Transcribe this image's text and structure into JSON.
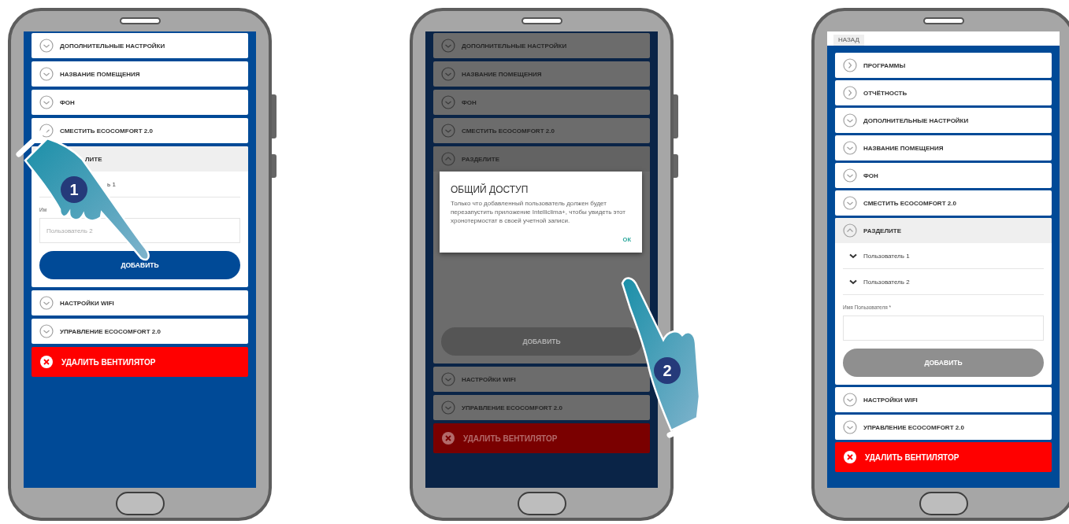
{
  "phones": [
    {
      "kind": "side_keys",
      "dimmed": false,
      "sections": [
        {
          "title": "ДОПОЛНИТЕЛЬНЫЕ НАСТРОЙКИ",
          "kind": "accordion",
          "expanded": false
        },
        {
          "title": "НАЗВАНИЕ ПОМЕЩЕНИЯ",
          "kind": "accordion",
          "expanded": false
        },
        {
          "title": "ФОН",
          "kind": "accordion",
          "expanded": false
        },
        {
          "title": "СМЕСТИТЬ ECOCOMFORT 2.0",
          "kind": "accordion",
          "expanded": false
        },
        {
          "title": "ЛИТЕ",
          "kind": "covered",
          "expanded": true,
          "users": [
            {
              "name": "ь 1",
              "kind": "covered"
            }
          ],
          "field_label": "Им",
          "field_placeholder": "Пользователь 2",
          "add_button": {
            "label": "ДОБАВИТЬ",
            "disabled": false
          }
        },
        {
          "title": "НАСТРОЙКИ WIFI",
          "kind": "accordion",
          "expanded": false
        },
        {
          "title": "УПРАВЛЕНИЕ ECOCOMFORT 2.0",
          "kind": "accordion",
          "expanded": false
        }
      ],
      "delete_button": "УДАЛИТЬ ВЕНТИЛЯТОР",
      "hand": {
        "step": "1",
        "kind": "from_top"
      }
    },
    {
      "kind": "side_keys",
      "dimmed": true,
      "sections": [
        {
          "title": "ДОПОЛНИТЕЛЬНЫЕ НАСТРОЙКИ",
          "kind": "accordion",
          "expanded": false
        },
        {
          "title": "НАЗВАНИЕ ПОМЕЩЕНИЯ",
          "kind": "accordion",
          "expanded": false
        },
        {
          "title": "ФОН",
          "kind": "accordion",
          "expanded": false
        },
        {
          "title": "СМЕСТИТЬ ECOCOMFORT 2.0",
          "kind": "accordion",
          "expanded": false
        },
        {
          "title": "РАЗДЕЛИТЕ",
          "kind": "accordion",
          "expanded": true,
          "add_button": {
            "label": "ДОБАВИТЬ",
            "disabled": true
          }
        },
        {
          "title": "НАСТРОЙКИ WIFI",
          "kind": "accordion",
          "expanded": false
        },
        {
          "title": "УПРАВЛЕНИЕ ECOCOMFORT 2.0",
          "kind": "accordion",
          "expanded": false
        }
      ],
      "delete_button": "УДАЛИТЬ ВЕНТИЛЯТОР",
      "modal": {
        "title": "ОБЩИЙ ДОСТУП",
        "text": "Только что добавленный пользователь должен будет перезапустить приложение Intelliclima+, чтобы увидеть этот хронотермостат в своей учетной записи.",
        "ok": "ОК"
      },
      "hand": {
        "step": "2",
        "kind": "from_bottom"
      }
    },
    {
      "kind": "plain",
      "dimmed": false,
      "back_tab": "НАЗАД",
      "sections": [
        {
          "title": "ПРОГРАММЫ",
          "kind": "link",
          "expanded": false
        },
        {
          "title": "ОТЧЁТНОСТЬ",
          "kind": "link",
          "expanded": false
        },
        {
          "title": "ДОПОЛНИТЕЛЬНЫЕ НАСТРОЙКИ",
          "kind": "accordion",
          "expanded": false
        },
        {
          "title": "НАЗВАНИЕ ПОМЕЩЕНИЯ",
          "kind": "accordion",
          "expanded": false
        },
        {
          "title": "ФОН",
          "kind": "accordion",
          "expanded": false
        },
        {
          "title": "СМЕСТИТЬ ECOCOMFORT 2.0",
          "kind": "accordion",
          "expanded": false
        },
        {
          "title": "РАЗДЕЛИТЕ",
          "kind": "accordion",
          "expanded": true,
          "users": [
            {
              "name": "Пользователь 1",
              "kind": "dropdown"
            },
            {
              "name": "Пользователь 2",
              "kind": "dropdown"
            }
          ],
          "field_label": "Имя Пользователя *",
          "add_button": {
            "label": "ДОБАВИТЬ",
            "disabled": true
          }
        },
        {
          "title": "НАСТРОЙКИ WIFI",
          "kind": "accordion",
          "expanded": false
        },
        {
          "title": "УПРАВЛЕНИЕ ECOCOMFORT 2.0",
          "kind": "accordion",
          "expanded": false
        }
      ],
      "delete_button": "УДАЛИТЬ ВЕНТИЛЯТОР"
    }
  ]
}
